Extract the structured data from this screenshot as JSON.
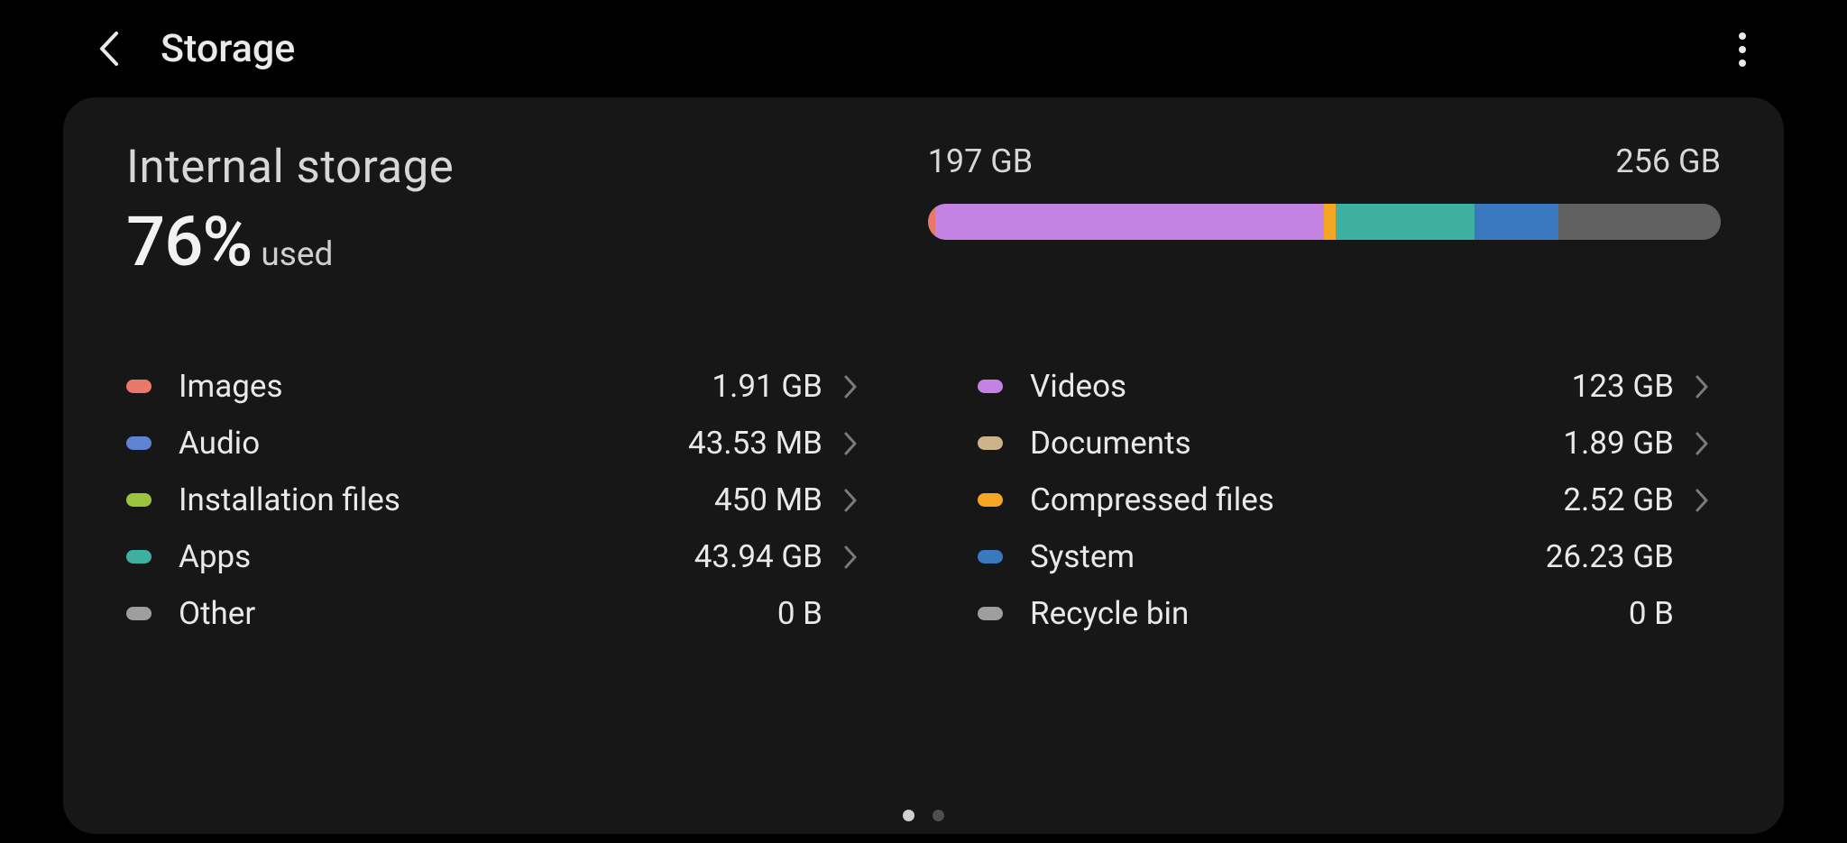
{
  "header": {
    "title": "Storage"
  },
  "summary": {
    "title": "Internal storage",
    "percent": "76%",
    "used_label": "used",
    "used_display": "197 GB",
    "total_display": "256 GB"
  },
  "bar_segments": [
    {
      "name": "Images",
      "color": "#ea7869",
      "pct": 1
    },
    {
      "name": "Videos",
      "color": "#c483e2",
      "pct": 49
    },
    {
      "name": "Compressed files",
      "color": "#f5a623",
      "pct": 1.5
    },
    {
      "name": "Apps",
      "color": "#3eb0a1",
      "pct": 17.5
    },
    {
      "name": "System",
      "color": "#3a78bf",
      "pct": 10.5
    },
    {
      "name": "Free",
      "color": "#616161",
      "pct": 20.5
    }
  ],
  "categories": [
    {
      "id": "images",
      "label": "Images",
      "size": "1.91 GB",
      "color": "#ea7869",
      "chevron": true
    },
    {
      "id": "videos",
      "label": "Videos",
      "size": "123 GB",
      "color": "#c483e2",
      "chevron": true
    },
    {
      "id": "audio",
      "label": "Audio",
      "size": "43.53 MB",
      "color": "#5e83d2",
      "chevron": true
    },
    {
      "id": "documents",
      "label": "Documents",
      "size": "1.89 GB",
      "color": "#cbb38a",
      "chevron": true
    },
    {
      "id": "install",
      "label": "Installation files",
      "size": "450 MB",
      "color": "#9bc53d",
      "chevron": true
    },
    {
      "id": "compressed",
      "label": "Compressed files",
      "size": "2.52 GB",
      "color": "#f5a623",
      "chevron": true
    },
    {
      "id": "apps",
      "label": "Apps",
      "size": "43.94 GB",
      "color": "#3eb0a1",
      "chevron": true
    },
    {
      "id": "system",
      "label": "System",
      "size": "26.23 GB",
      "color": "#3a78bf",
      "chevron": false
    },
    {
      "id": "other",
      "label": "Other",
      "size": "0 B",
      "color": "#9e9e9e",
      "chevron": false
    },
    {
      "id": "recycle",
      "label": "Recycle bin",
      "size": "0 B",
      "color": "#9e9e9e",
      "chevron": false
    }
  ],
  "pager": {
    "page_count": 2,
    "active_index": 0
  }
}
